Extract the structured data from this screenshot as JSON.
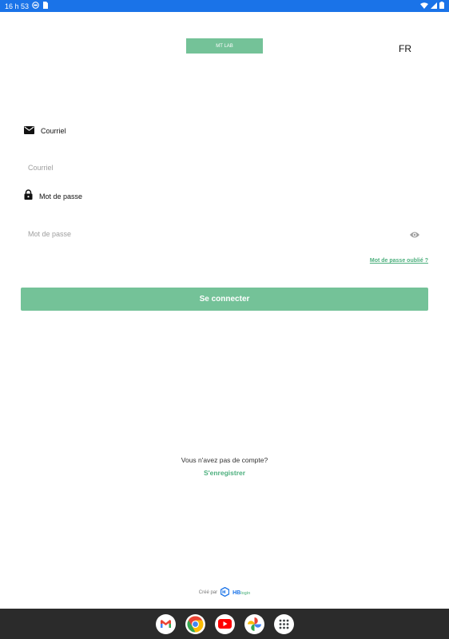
{
  "status_bar": {
    "time": "16 h 53",
    "bg_color": "#1a73e8"
  },
  "header": {
    "logo_text": "MT LAB",
    "language": "FR",
    "brand_color": "#74c298"
  },
  "form": {
    "email_label": "Courriel",
    "email_placeholder": "Courriel",
    "password_label": "Mot de passe",
    "password_placeholder": "Mot de passe",
    "forgot_password": "Mot de passe oublié ?",
    "login_button": "Se connecter"
  },
  "signup": {
    "prompt": "Vous n'avez pas de compte?",
    "link": "S'enregistrer"
  },
  "footer": {
    "created_by": "Créé par",
    "brand": "HB",
    "brand_sub": "login"
  },
  "dock": {
    "apps": [
      "gmail-icon",
      "chrome-icon",
      "youtube-icon",
      "photos-icon",
      "app-drawer-icon"
    ]
  }
}
